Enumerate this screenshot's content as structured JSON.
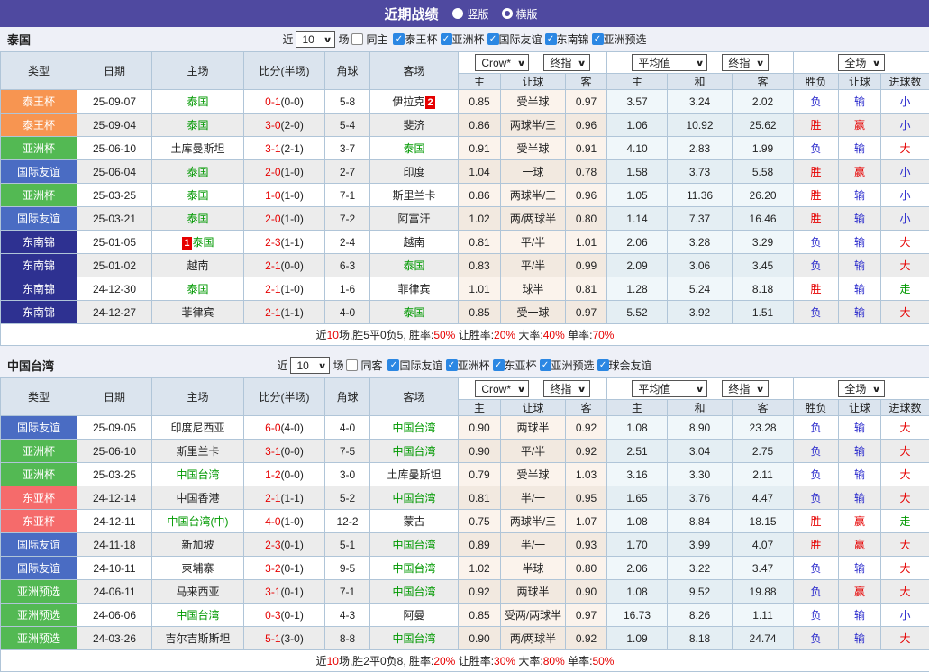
{
  "title_bar": {
    "title": "近期战绩",
    "radios": [
      {
        "label": "竖版",
        "selected": true
      },
      {
        "label": "横版",
        "selected": false
      }
    ]
  },
  "table_header": {
    "cols": [
      "类型",
      "日期",
      "主场",
      "比分(半场)",
      "角球",
      "客场"
    ],
    "sub": [
      "主",
      "让球",
      "客",
      "主",
      "和",
      "客",
      "胜负",
      "让球",
      "进球数"
    ],
    "selects": {
      "bookmaker": "Crow*",
      "final1": "终指",
      "average": "平均值",
      "final2": "终指",
      "scope": "全场"
    }
  },
  "type_colors": {
    "泰王杯": "#f79551",
    "亚洲杯": "#53b953",
    "国际友谊": "#4a6cc3",
    "东南锦": "#2e3191",
    "东亚杯": "#f56b6b",
    "亚洲预选": "#53b953"
  },
  "result_colors": {
    "胜": "#e60000",
    "负": "#2828cc",
    "赢": "#e60000",
    "输": "#2828cc",
    "大": "#e60000",
    "小": "#2828cc",
    "走": "#009900"
  },
  "sections": [
    {
      "team": "泰国",
      "filter": {
        "near_label": "近",
        "matches": "10",
        "games_label": "场",
        "same_label": "同主",
        "same_checked": false,
        "leagues": [
          "泰王杯",
          "亚洲杯",
          "国际友谊",
          "东南锦",
          "亚洲预选"
        ]
      },
      "rows": [
        {
          "type": "泰王杯",
          "date": "25-09-07",
          "home": "泰国",
          "home_self": true,
          "score": "0-1",
          "half": "(0-0)",
          "corner": "5-8",
          "away": "伊拉克",
          "away_badge": "2",
          "asia": [
            "0.85",
            "受半球",
            "0.97"
          ],
          "euro": [
            "3.57",
            "3.24",
            "2.02"
          ],
          "results": [
            "负",
            "输",
            "小"
          ]
        },
        {
          "type": "泰王杯",
          "date": "25-09-04",
          "home": "泰国",
          "home_self": true,
          "score": "3-0",
          "half": "(2-0)",
          "corner": "5-4",
          "away": "斐济",
          "asia": [
            "0.86",
            "两球半/三",
            "0.96"
          ],
          "euro": [
            "1.06",
            "10.92",
            "25.62"
          ],
          "results": [
            "胜",
            "赢",
            "小"
          ]
        },
        {
          "type": "亚洲杯",
          "date": "25-06-10",
          "home": "土库曼斯坦",
          "score": "3-1",
          "half": "(2-1)",
          "corner": "3-7",
          "away": "泰国",
          "away_self": true,
          "asia": [
            "0.91",
            "受半球",
            "0.91"
          ],
          "euro": [
            "4.10",
            "2.83",
            "1.99"
          ],
          "results": [
            "负",
            "输",
            "大"
          ]
        },
        {
          "type": "国际友谊",
          "date": "25-06-04",
          "home": "泰国",
          "home_self": true,
          "score": "2-0",
          "half": "(1-0)",
          "corner": "2-7",
          "away": "印度",
          "asia": [
            "1.04",
            "一球",
            "0.78"
          ],
          "euro": [
            "1.58",
            "3.73",
            "5.58"
          ],
          "results": [
            "胜",
            "赢",
            "小"
          ]
        },
        {
          "type": "亚洲杯",
          "date": "25-03-25",
          "home": "泰国",
          "home_self": true,
          "score": "1-0",
          "half": "(1-0)",
          "corner": "7-1",
          "away": "斯里兰卡",
          "asia": [
            "0.86",
            "两球半/三",
            "0.96"
          ],
          "euro": [
            "1.05",
            "11.36",
            "26.20"
          ],
          "results": [
            "胜",
            "输",
            "小"
          ]
        },
        {
          "type": "国际友谊",
          "date": "25-03-21",
          "home": "泰国",
          "home_self": true,
          "score": "2-0",
          "half": "(1-0)",
          "corner": "7-2",
          "away": "阿富汗",
          "asia": [
            "1.02",
            "两/两球半",
            "0.80"
          ],
          "euro": [
            "1.14",
            "7.37",
            "16.46"
          ],
          "results": [
            "胜",
            "输",
            "小"
          ]
        },
        {
          "type": "东南锦",
          "date": "25-01-05",
          "home": "泰国",
          "home_self": true,
          "home_badge": "1",
          "score": "2-3",
          "half": "(1-1)",
          "corner": "2-4",
          "away": "越南",
          "asia": [
            "0.81",
            "平/半",
            "1.01"
          ],
          "euro": [
            "2.06",
            "3.28",
            "3.29"
          ],
          "results": [
            "负",
            "输",
            "大"
          ]
        },
        {
          "type": "东南锦",
          "date": "25-01-02",
          "home": "越南",
          "score": "2-1",
          "half": "(0-0)",
          "corner": "6-3",
          "away": "泰国",
          "away_self": true,
          "asia": [
            "0.83",
            "平/半",
            "0.99"
          ],
          "euro": [
            "2.09",
            "3.06",
            "3.45"
          ],
          "results": [
            "负",
            "输",
            "大"
          ]
        },
        {
          "type": "东南锦",
          "date": "24-12-30",
          "home": "泰国",
          "home_self": true,
          "score": "2-1",
          "half": "(1-0)",
          "corner": "1-6",
          "away": "菲律宾",
          "asia": [
            "1.01",
            "球半",
            "0.81"
          ],
          "euro": [
            "1.28",
            "5.24",
            "8.18"
          ],
          "results": [
            "胜",
            "输",
            "走"
          ]
        },
        {
          "type": "东南锦",
          "date": "24-12-27",
          "home": "菲律宾",
          "score": "2-1",
          "half": "(1-1)",
          "corner": "4-0",
          "away": "泰国",
          "away_self": true,
          "asia": [
            "0.85",
            "受一球",
            "0.97"
          ],
          "euro": [
            "5.52",
            "3.92",
            "1.51"
          ],
          "results": [
            "负",
            "输",
            "大"
          ]
        }
      ],
      "summary": [
        {
          "t": "近",
          "r": false
        },
        {
          "t": "10",
          "r": true
        },
        {
          "t": "场,胜5平0负5, 胜率:",
          "r": false
        },
        {
          "t": "50%",
          "r": true
        },
        {
          "t": " 让胜率:",
          "r": false
        },
        {
          "t": "20%",
          "r": true
        },
        {
          "t": " 大率:",
          "r": false
        },
        {
          "t": "40%",
          "r": true
        },
        {
          "t": " 单率:",
          "r": false
        },
        {
          "t": "70%",
          "r": true
        }
      ]
    },
    {
      "team": "中国台湾",
      "filter": {
        "near_label": "近",
        "matches": "10",
        "games_label": "场",
        "same_label": "同客",
        "same_checked": false,
        "leagues": [
          "国际友谊",
          "亚洲杯",
          "东亚杯",
          "亚洲预选",
          "球会友谊"
        ]
      },
      "rows": [
        {
          "type": "国际友谊",
          "date": "25-09-05",
          "home": "印度尼西亚",
          "score": "6-0",
          "half": "(4-0)",
          "corner": "4-0",
          "away": "中国台湾",
          "away_self": true,
          "asia": [
            "0.90",
            "两球半",
            "0.92"
          ],
          "euro": [
            "1.08",
            "8.90",
            "23.28"
          ],
          "results": [
            "负",
            "输",
            "大"
          ]
        },
        {
          "type": "亚洲杯",
          "date": "25-06-10",
          "home": "斯里兰卡",
          "score": "3-1",
          "half": "(0-0)",
          "corner": "7-5",
          "away": "中国台湾",
          "away_self": true,
          "asia": [
            "0.90",
            "平/半",
            "0.92"
          ],
          "euro": [
            "2.51",
            "3.04",
            "2.75"
          ],
          "results": [
            "负",
            "输",
            "大"
          ]
        },
        {
          "type": "亚洲杯",
          "date": "25-03-25",
          "home": "中国台湾",
          "home_self": true,
          "score": "1-2",
          "half": "(0-0)",
          "corner": "3-0",
          "away": "土库曼斯坦",
          "asia": [
            "0.79",
            "受半球",
            "1.03"
          ],
          "euro": [
            "3.16",
            "3.30",
            "2.11"
          ],
          "results": [
            "负",
            "输",
            "大"
          ]
        },
        {
          "type": "东亚杯",
          "date": "24-12-14",
          "home": "中国香港",
          "score": "2-1",
          "half": "(1-1)",
          "corner": "5-2",
          "away": "中国台湾",
          "away_self": true,
          "asia": [
            "0.81",
            "半/一",
            "0.95"
          ],
          "euro": [
            "1.65",
            "3.76",
            "4.47"
          ],
          "results": [
            "负",
            "输",
            "大"
          ]
        },
        {
          "type": "东亚杯",
          "date": "24-12-11",
          "home": "中国台湾(中)",
          "home_self": true,
          "score": "4-0",
          "half": "(1-0)",
          "corner": "12-2",
          "away": "蒙古",
          "asia": [
            "0.75",
            "两球半/三",
            "1.07"
          ],
          "euro": [
            "1.08",
            "8.84",
            "18.15"
          ],
          "results": [
            "胜",
            "赢",
            "走"
          ]
        },
        {
          "type": "国际友谊",
          "date": "24-11-18",
          "home": "新加坡",
          "score": "2-3",
          "half": "(0-1)",
          "corner": "5-1",
          "away": "中国台湾",
          "away_self": true,
          "asia": [
            "0.89",
            "半/一",
            "0.93"
          ],
          "euro": [
            "1.70",
            "3.99",
            "4.07"
          ],
          "results": [
            "胜",
            "赢",
            "大"
          ]
        },
        {
          "type": "国际友谊",
          "date": "24-10-11",
          "home": "柬埔寨",
          "score": "3-2",
          "half": "(0-1)",
          "corner": "9-5",
          "away": "中国台湾",
          "away_self": true,
          "asia": [
            "1.02",
            "半球",
            "0.80"
          ],
          "euro": [
            "2.06",
            "3.22",
            "3.47"
          ],
          "results": [
            "负",
            "输",
            "大"
          ]
        },
        {
          "type": "亚洲预选",
          "date": "24-06-11",
          "home": "马来西亚",
          "score": "3-1",
          "half": "(0-1)",
          "corner": "7-1",
          "away": "中国台湾",
          "away_self": true,
          "asia": [
            "0.92",
            "两球半",
            "0.90"
          ],
          "euro": [
            "1.08",
            "9.52",
            "19.88"
          ],
          "results": [
            "负",
            "赢",
            "大"
          ]
        },
        {
          "type": "亚洲预选",
          "date": "24-06-06",
          "home": "中国台湾",
          "home_self": true,
          "score": "0-3",
          "half": "(0-1)",
          "corner": "4-3",
          "away": "阿曼",
          "asia": [
            "0.85",
            "受两/两球半",
            "0.97"
          ],
          "euro": [
            "16.73",
            "8.26",
            "1.11"
          ],
          "results": [
            "负",
            "输",
            "小"
          ]
        },
        {
          "type": "亚洲预选",
          "date": "24-03-26",
          "home": "吉尔吉斯斯坦",
          "score": "5-1",
          "half": "(3-0)",
          "corner": "8-8",
          "away": "中国台湾",
          "away_self": true,
          "asia": [
            "0.90",
            "两/两球半",
            "0.92"
          ],
          "euro": [
            "1.09",
            "8.18",
            "24.74"
          ],
          "results": [
            "负",
            "输",
            "大"
          ]
        }
      ],
      "summary": [
        {
          "t": "近",
          "r": false
        },
        {
          "t": "10",
          "r": true
        },
        {
          "t": "场,胜2平0负8, 胜率:",
          "r": false
        },
        {
          "t": "20%",
          "r": true
        },
        {
          "t": " 让胜率:",
          "r": false
        },
        {
          "t": "30%",
          "r": true
        },
        {
          "t": " 大率:",
          "r": false
        },
        {
          "t": "80%",
          "r": true
        },
        {
          "t": " 单率:",
          "r": false
        },
        {
          "t": "50%",
          "r": true
        }
      ]
    }
  ]
}
